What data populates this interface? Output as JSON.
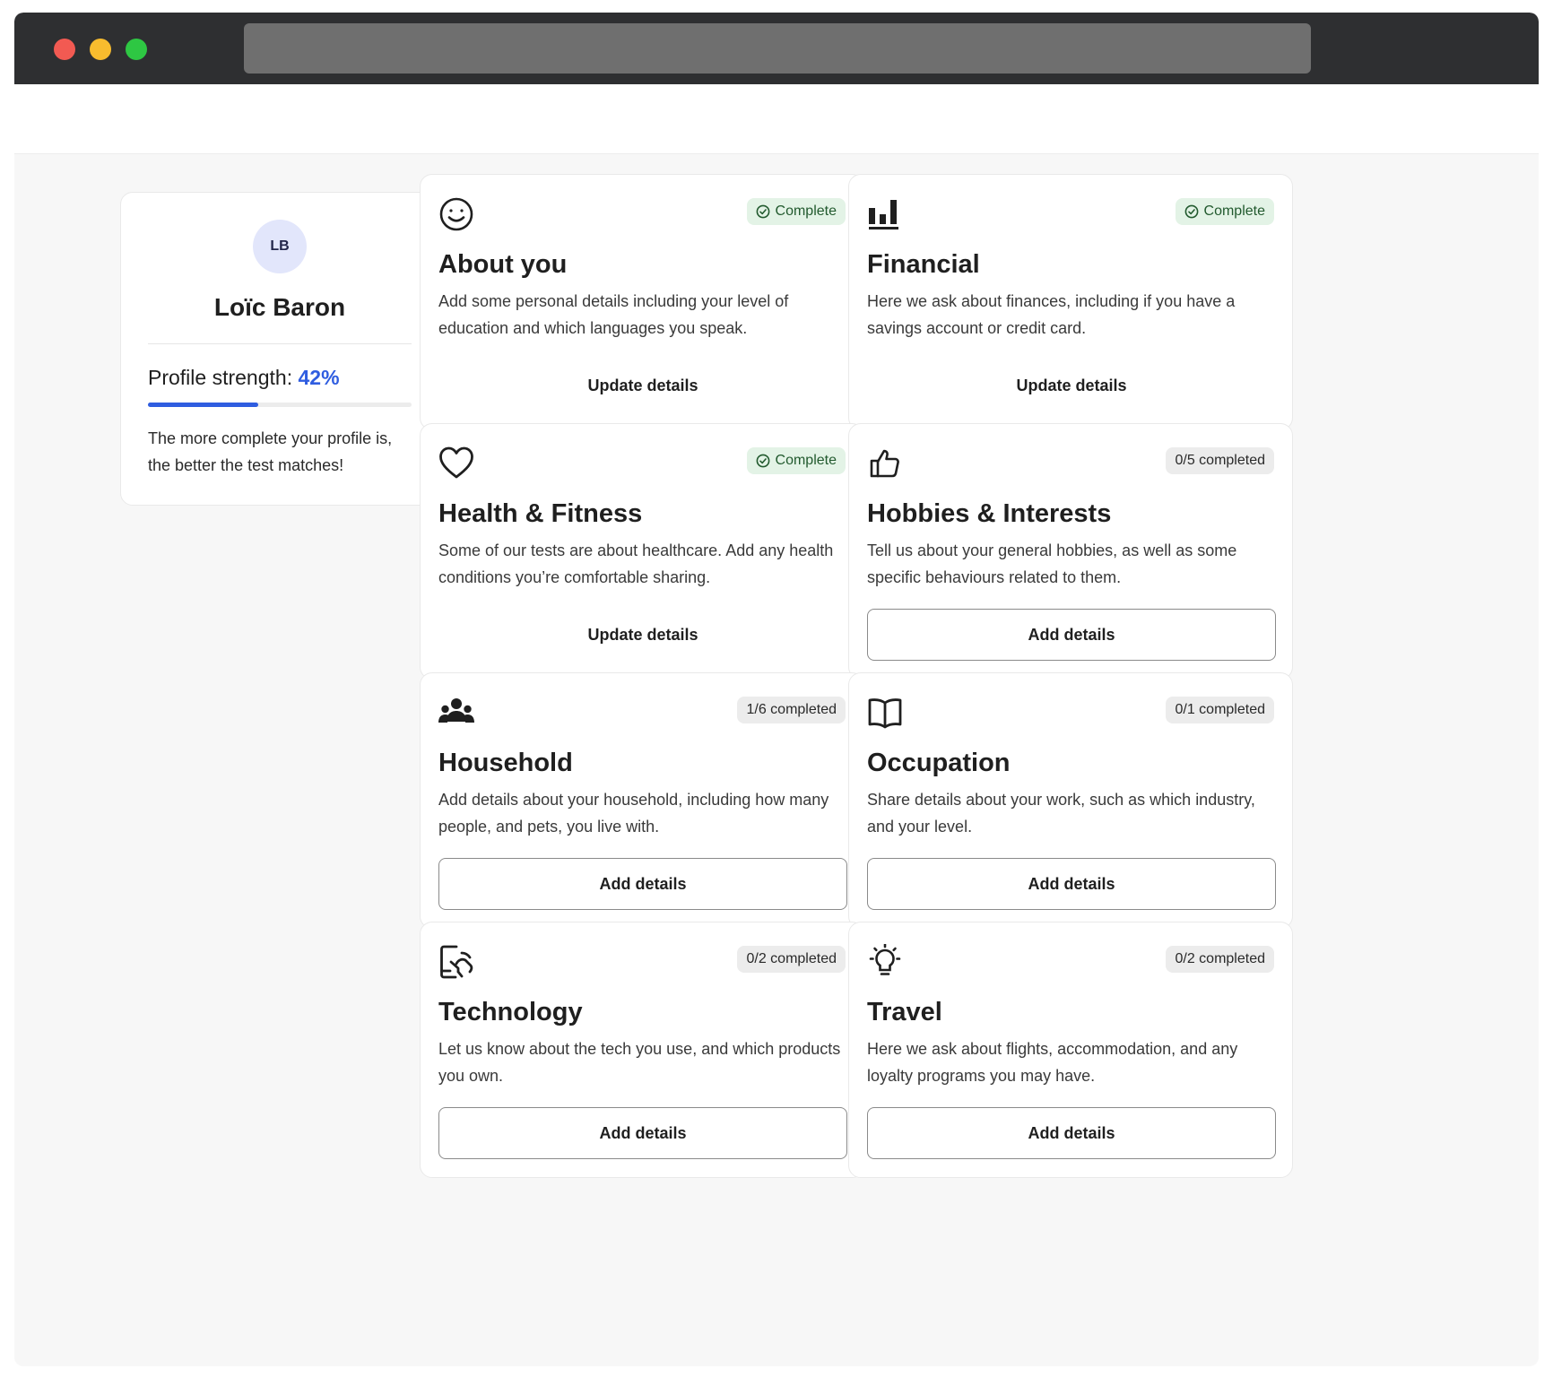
{
  "window": {
    "controls": [
      "close",
      "minimize",
      "maximize"
    ]
  },
  "profile": {
    "initials": "LB",
    "name": "Loïc Baron",
    "strength_label": "Profile strength:",
    "strength_value": "42%",
    "strength_fraction": 0.42,
    "note": "The more complete your profile is, the better the test matches!"
  },
  "colors": {
    "accent": "#2f5de0",
    "complete_badge_bg": "#e3f3e6",
    "complete_badge_text": "#225a2e",
    "progress_badge_bg": "#ececec"
  },
  "cards": [
    {
      "icon": "smiley-icon",
      "badge": "Complete",
      "complete": true,
      "title": "About you",
      "desc": "Add some personal details including your level of education and which languages you speak.",
      "action": "Update details",
      "action_style": "link"
    },
    {
      "icon": "bar-chart-icon",
      "badge": "Complete",
      "complete": true,
      "title": "Financial",
      "desc": "Here we ask about finances, including if you have a savings account or credit card.",
      "action": "Update details",
      "action_style": "link"
    },
    {
      "icon": "heart-icon",
      "badge": "Complete",
      "complete": true,
      "title": "Health & Fitness",
      "desc": "Some of our tests are about healthcare. Add any health conditions you’re comfortable sharing.",
      "action": "Update details",
      "action_style": "link"
    },
    {
      "icon": "thumbs-up-icon",
      "badge": "0/5 completed",
      "complete": false,
      "title": "Hobbies & Interests",
      "desc": "Tell us about your general hobbies, as well as some specific behaviours related to them.",
      "action": "Add details",
      "action_style": "outline"
    },
    {
      "icon": "people-icon",
      "badge": "1/6 completed",
      "complete": false,
      "title": "Household",
      "desc": "Add details about your household, including how many people, and pets, you live with.",
      "action": "Add details",
      "action_style": "outline"
    },
    {
      "icon": "book-icon",
      "badge": "0/1 completed",
      "complete": false,
      "title": "Occupation",
      "desc": "Share details about your work, such as which industry, and your level.",
      "action": "Add details",
      "action_style": "outline"
    },
    {
      "icon": "phone-touch-icon",
      "badge": "0/2 completed",
      "complete": false,
      "title": "Technology",
      "desc": "Let us know about the tech you use, and which products you own.",
      "action": "Add details",
      "action_style": "outline"
    },
    {
      "icon": "lightbulb-icon",
      "badge": "0/2 completed",
      "complete": false,
      "title": "Travel",
      "desc": "Here we ask about flights, accommodation, and any loyalty programs you may have.",
      "action": "Add details",
      "action_style": "outline"
    }
  ]
}
